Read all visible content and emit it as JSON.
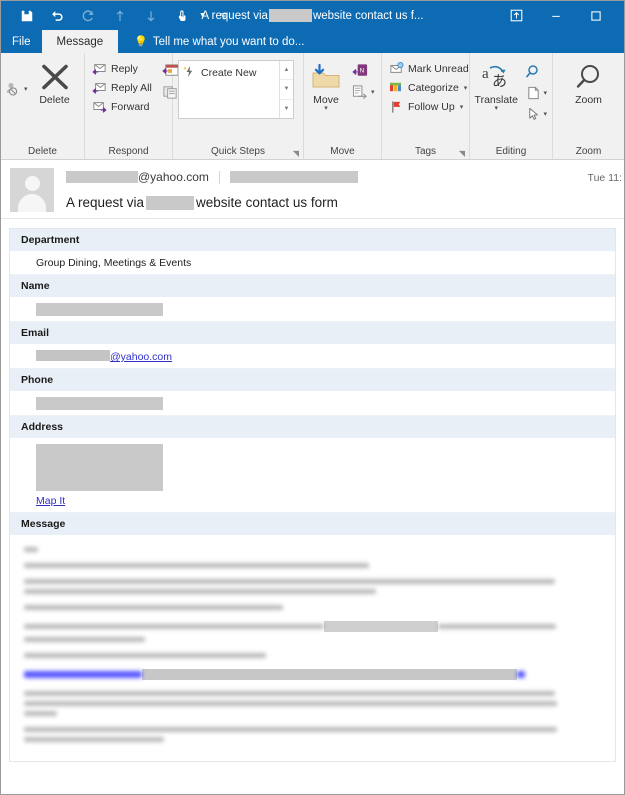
{
  "window": {
    "title_prefix": "A request via ",
    "title_suffix": "website contact us f...",
    "quick_access": [
      {
        "name": "save",
        "label": "Save",
        "enabled": true
      },
      {
        "name": "undo",
        "label": "Undo",
        "enabled": true
      },
      {
        "name": "redo",
        "label": "Redo",
        "enabled": false
      },
      {
        "name": "previous-item",
        "label": "Previous Item",
        "enabled": false
      },
      {
        "name": "next-item",
        "label": "Next Item",
        "enabled": false
      },
      {
        "name": "touch-mouse-mode",
        "label": "Touch/Mouse Mode",
        "enabled": true
      },
      {
        "name": "customize-quick-access-toolbar",
        "label": "Customize Quick Access Toolbar",
        "enabled": true
      }
    ],
    "controls": [
      {
        "name": "pop-out",
        "label": "Pop Out"
      },
      {
        "name": "minimize",
        "label": "Minimize"
      },
      {
        "name": "maximize",
        "label": "Maximize"
      }
    ]
  },
  "tabs": {
    "file": "File",
    "message": "Message",
    "tellme": "Tell me what you want to do..."
  },
  "ribbon": {
    "groups": [
      {
        "name": "delete",
        "label": "Delete"
      },
      {
        "name": "respond",
        "label": "Respond"
      },
      {
        "name": "quick-steps",
        "label": "Quick Steps"
      },
      {
        "name": "move",
        "label": "Move"
      },
      {
        "name": "tags",
        "label": "Tags"
      },
      {
        "name": "editing",
        "label": "Editing"
      },
      {
        "name": "zoom",
        "label": "Zoom"
      }
    ],
    "delete": {
      "ignore_label": "Ignore",
      "delete_label": "Delete"
    },
    "respond": {
      "reply": "Reply",
      "reply_all": "Reply All",
      "forward": "Forward",
      "meeting": "Meeting",
      "more": "More"
    },
    "quick_steps": {
      "create_new": "Create New"
    },
    "move": {
      "move": "Move",
      "onenote": "OneNote",
      "rules": "Rules"
    },
    "tags": {
      "mark_unread": "Mark Unread",
      "categorize": "Categorize",
      "follow_up": "Follow Up"
    },
    "editing": {
      "translate": "Translate",
      "find": "Find",
      "related": "Related",
      "select": "Select"
    },
    "zoom": {
      "zoom": "Zoom"
    }
  },
  "message": {
    "sender_domain": "@yahoo.com",
    "subject_prefix": "A request via ",
    "subject_suffix": "website contact us form",
    "received": "Tue 11:",
    "form_fields": [
      {
        "label": "Department",
        "value": "Group Dining, Meetings & Events",
        "type": "text"
      },
      {
        "label": "Name",
        "value": "",
        "type": "redacted-short"
      },
      {
        "label": "Email",
        "value": "@yahoo.com",
        "type": "email-link"
      },
      {
        "label": "Phone",
        "value": "",
        "type": "redacted-short"
      },
      {
        "label": "Address",
        "value": "",
        "type": "redacted-block",
        "link": "Map It"
      }
    ],
    "message_label": "Message",
    "body_blurred": true,
    "body_paragraphs": [
      {
        "lines": [
          14
        ]
      },
      {
        "lines": [
          345
        ]
      },
      {
        "lines": [
          531,
          352
        ]
      },
      {
        "lines": [
          259
        ]
      },
      {
        "lines": [
          533,
          121
        ]
      },
      {
        "lines": [
          242
        ]
      },
      {
        "lines": [
          531,
          533,
          33
        ]
      },
      {
        "lines": [
          533,
          140
        ]
      }
    ]
  },
  "colors": {
    "titlebar": "#0d6bb3",
    "ribbon_bg": "#f1f1f1",
    "field_label_bg": "#e9eff6",
    "link": "#2f2fc8",
    "redaction": "#c9c9c9"
  }
}
